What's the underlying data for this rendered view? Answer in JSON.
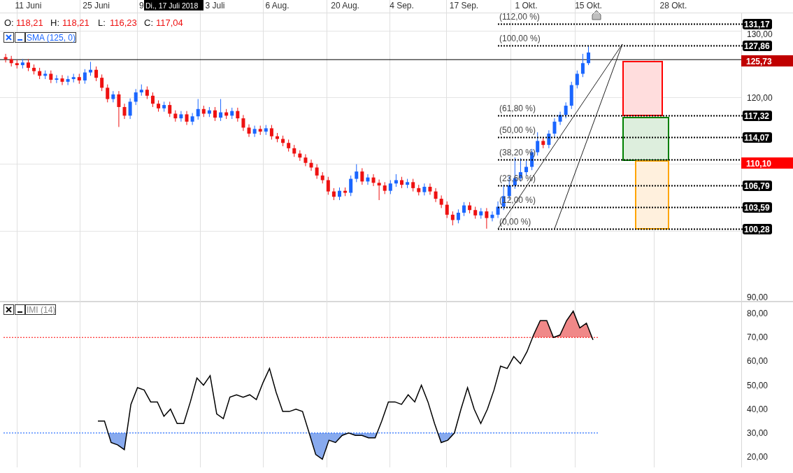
{
  "date_axis": {
    "crosshair_date": "Di., 17 Juli 2018"
  },
  "ohlc": [
    {
      "label": "O:",
      "value": "118,21"
    },
    {
      "label": "H:",
      "value": "118,21"
    },
    {
      "label": "L:",
      "value": "116,23"
    },
    {
      "label": "C:",
      "value": "117,04"
    }
  ],
  "price_indicator": {
    "name": "SMA (125, 0)"
  },
  "price_pane": {
    "chart_data": {
      "type": "candlestick",
      "grid": true,
      "ylim": [
        89.44,
        134.7
      ],
      "categories": [
        null,
        null,
        null,
        null,
        "11 Juni",
        null,
        null,
        null,
        null,
        null,
        null,
        null,
        null,
        null,
        null,
        null,
        "25 Juni",
        null,
        null,
        null,
        null,
        null,
        null,
        null,
        "9",
        null,
        null,
        null,
        null,
        null,
        null,
        null,
        null,
        null,
        null,
        null,
        null,
        "3 Juli",
        null,
        null,
        null,
        null,
        null,
        null,
        null,
        null,
        null,
        null,
        "6 Aug.",
        null,
        null,
        null,
        null,
        null,
        null,
        null,
        null,
        null,
        null,
        null,
        "20 Aug.",
        null,
        null,
        null,
        null,
        null,
        null,
        null,
        null,
        null,
        "4 Sep.",
        null,
        null,
        null,
        null,
        null,
        null,
        null,
        null,
        null,
        null,
        "17 Sep.",
        null,
        null,
        null,
        null,
        null,
        null,
        null,
        null,
        null,
        null,
        "1 Okt.",
        null,
        null,
        null,
        null,
        null,
        null,
        null,
        null,
        null,
        null,
        "15 Okt.",
        null,
        null,
        null,
        null,
        null,
        null,
        null,
        null,
        null,
        null,
        null,
        null,
        null,
        null,
        "28 Okt.",
        null,
        null,
        null,
        null,
        null,
        null,
        null,
        null,
        null,
        null,
        null
      ],
      "ref_lines": [
        {
          "axis": "y",
          "value": 125.73,
          "color": "#000000"
        }
      ],
      "yticks": [
        {
          "value": 130,
          "label": "130,00"
        },
        {
          "value": 120,
          "label": "120,00"
        },
        {
          "value": 90,
          "label": "90,00"
        }
      ],
      "ohlc": [
        [
          126.1,
          126.6,
          125.3,
          125.8
        ],
        [
          125.8,
          126.3,
          124.7,
          125.2
        ],
        [
          125.2,
          125.7,
          124.4,
          124.9
        ],
        [
          124.9,
          125.8,
          124.4,
          125.3
        ],
        [
          125.3,
          125.8,
          124.0,
          124.5
        ],
        [
          124.5,
          125.0,
          123.5,
          124.0
        ],
        [
          124.0,
          124.5,
          122.8,
          123.3
        ],
        [
          123.3,
          124.1,
          122.8,
          123.6
        ],
        [
          123.6,
          124.1,
          122.2,
          122.7
        ],
        [
          122.7,
          123.4,
          122.2,
          122.9
        ],
        [
          122.9,
          123.4,
          121.9,
          122.4
        ],
        [
          122.4,
          123.3,
          121.9,
          122.8
        ],
        [
          122.8,
          123.6,
          122.3,
          123.1
        ],
        [
          123.1,
          123.6,
          122.1,
          122.6
        ],
        [
          122.6,
          124.3,
          122.1,
          123.8
        ],
        [
          123.8,
          125.4,
          123.3,
          124.2
        ],
        [
          124.2,
          124.7,
          122.5,
          123.0
        ],
        [
          123.0,
          123.5,
          121.0,
          121.5
        ],
        [
          121.5,
          122.0,
          119.3,
          119.8
        ],
        [
          119.8,
          121.0,
          119.3,
          120.5
        ],
        [
          120.5,
          121.0,
          115.6,
          118.6
        ],
        [
          118.6,
          119.1,
          116.8,
          117.3
        ],
        [
          117.3,
          119.9,
          116.8,
          119.4
        ],
        [
          119.4,
          121.3,
          118.9,
          120.8
        ],
        [
          120.8,
          122.0,
          120.3,
          121.2
        ],
        [
          121.2,
          121.7,
          119.8,
          120.3
        ],
        [
          120.3,
          120.8,
          118.6,
          119.1
        ],
        [
          119.1,
          119.6,
          117.9,
          118.4
        ],
        [
          118.4,
          119.4,
          117.9,
          118.9
        ],
        [
          118.9,
          119.4,
          117.1,
          117.6
        ],
        [
          117.6,
          118.1,
          116.4,
          116.9
        ],
        [
          116.9,
          118.0,
          116.4,
          117.5
        ],
        [
          117.5,
          118.0,
          115.9,
          116.4
        ],
        [
          116.4,
          117.7,
          115.9,
          117.2
        ],
        [
          117.2,
          119.8,
          116.7,
          118.3
        ],
        [
          118.3,
          118.8,
          117.1,
          117.6
        ],
        [
          117.6,
          118.6,
          117.1,
          118.1
        ],
        [
          118.1,
          118.6,
          116.5,
          117.0
        ],
        [
          117.0,
          119.8,
          116.5,
          117.8
        ],
        [
          117.8,
          118.3,
          116.8,
          117.3
        ],
        [
          117.3,
          118.5,
          116.8,
          118.0
        ],
        [
          118.0,
          118.5,
          116.4,
          116.9
        ],
        [
          116.9,
          117.4,
          115.0,
          115.5
        ],
        [
          115.5,
          116.0,
          114.1,
          114.6
        ],
        [
          114.6,
          115.8,
          114.1,
          115.3
        ],
        [
          115.3,
          115.8,
          114.4,
          114.9
        ],
        [
          114.9,
          115.9,
          114.4,
          115.4
        ],
        [
          115.4,
          115.9,
          113.7,
          114.2
        ],
        [
          114.2,
          114.7,
          113.3,
          113.8
        ],
        [
          113.8,
          114.3,
          112.7,
          113.2
        ],
        [
          113.2,
          113.7,
          111.9,
          112.4
        ],
        [
          112.4,
          112.9,
          111.1,
          111.6
        ],
        [
          111.6,
          112.1,
          110.5,
          111.0
        ],
        [
          111.0,
          111.5,
          109.7,
          110.2
        ],
        [
          110.2,
          110.7,
          109.0,
          109.5
        ],
        [
          109.5,
          110.0,
          107.8,
          108.3
        ],
        [
          108.3,
          108.8,
          107.1,
          107.6
        ],
        [
          107.6,
          108.1,
          105.4,
          105.9
        ],
        [
          105.9,
          106.4,
          104.6,
          105.1
        ],
        [
          105.1,
          106.5,
          104.6,
          106.0
        ],
        [
          106.0,
          106.5,
          105.2,
          105.7
        ],
        [
          105.7,
          108.3,
          105.2,
          107.8
        ],
        [
          107.8,
          110.0,
          107.3,
          108.9
        ],
        [
          108.9,
          109.4,
          106.9,
          107.4
        ],
        [
          107.4,
          108.5,
          106.9,
          108.0
        ],
        [
          108.0,
          108.5,
          106.7,
          107.2
        ],
        [
          107.2,
          107.7,
          104.6,
          106.8
        ],
        [
          106.8,
          107.3,
          105.5,
          106.0
        ],
        [
          106.0,
          107.6,
          105.5,
          107.1
        ],
        [
          107.1,
          108.5,
          106.6,
          107.6
        ],
        [
          107.6,
          108.1,
          106.4,
          106.9
        ],
        [
          106.9,
          107.8,
          106.4,
          107.3
        ],
        [
          107.3,
          107.8,
          105.9,
          106.4
        ],
        [
          106.4,
          106.9,
          105.3,
          105.8
        ],
        [
          105.8,
          107.1,
          105.3,
          106.6
        ],
        [
          106.6,
          107.1,
          105.4,
          105.9
        ],
        [
          105.9,
          106.4,
          104.3,
          104.8
        ],
        [
          104.8,
          105.3,
          103.4,
          103.9
        ],
        [
          103.9,
          104.4,
          101.9,
          102.4
        ],
        [
          102.4,
          102.9,
          100.8,
          101.6
        ],
        [
          101.6,
          103.2,
          101.1,
          102.7
        ],
        [
          102.7,
          104.3,
          102.2,
          103.8
        ],
        [
          103.8,
          104.3,
          102.6,
          103.1
        ],
        [
          103.1,
          103.6,
          101.8,
          102.3
        ],
        [
          102.3,
          103.4,
          101.8,
          102.9
        ],
        [
          102.9,
          103.4,
          100.3,
          101.9
        ],
        [
          101.9,
          102.9,
          101.4,
          102.4
        ],
        [
          102.4,
          104.4,
          101.9,
          103.6
        ],
        [
          103.6,
          106.9,
          103.1,
          105.2
        ],
        [
          105.2,
          108.2,
          104.7,
          106.8
        ],
        [
          106.8,
          111.0,
          106.3,
          107.9
        ],
        [
          107.9,
          110.9,
          107.4,
          108.8
        ],
        [
          108.8,
          110.5,
          108.3,
          109.6
        ],
        [
          109.6,
          112.3,
          109.1,
          111.8
        ],
        [
          111.8,
          114.8,
          111.3,
          113.5
        ],
        [
          113.5,
          114.0,
          112.4,
          112.9
        ],
        [
          112.9,
          115.1,
          112.4,
          114.6
        ],
        [
          114.6,
          116.9,
          114.1,
          116.4
        ],
        [
          116.4,
          117.9,
          115.9,
          117.4
        ],
        [
          117.4,
          119.3,
          116.9,
          118.8
        ],
        [
          118.8,
          122.4,
          118.3,
          121.9
        ],
        [
          121.9,
          124.1,
          121.4,
          123.6
        ],
        [
          123.6,
          126.6,
          123.1,
          125.2
        ],
        [
          125.2,
          127.86,
          124.9,
          126.8
        ],
        null,
        null,
        null,
        null,
        null,
        null,
        null,
        null,
        null,
        null,
        null,
        null,
        null,
        null,
        null,
        null,
        null,
        null,
        null,
        null,
        null,
        null,
        null,
        null,
        null,
        null
      ]
    }
  },
  "fib_levels": [
    {
      "label": "(112,00 %)",
      "price": "131,17"
    },
    {
      "label": "(100,00 %)",
      "price": "127,86"
    },
    {
      "label": "(61,80 %)",
      "price": "117,32"
    },
    {
      "label": "(50,00 %)",
      "price": "114,07"
    },
    {
      "label": "(38,20 %)"
    },
    {
      "label": "(23,60 %)",
      "price": "106,79"
    },
    {
      "label": "(12,00 %)",
      "price": "103,59"
    },
    {
      "label": "(0,00 %)",
      "price": "100,28"
    }
  ],
  "price_markers": [
    {
      "price": "125,73",
      "color": "#c00000"
    },
    {
      "price": "110,10",
      "color": "#ff0000"
    }
  ],
  "zones": [
    {
      "color": "#ff0000"
    },
    {
      "color": "#008000"
    },
    {
      "color": "#ffa500"
    }
  ],
  "indicator_pane": {
    "chart_data": {
      "type": "line",
      "grid": true,
      "ylim": [
        15.6,
        85.3
      ],
      "yticks": [
        {
          "value": 80,
          "label": "80,00"
        },
        {
          "value": 70,
          "label": "70,00"
        },
        {
          "value": 60,
          "label": "60,00"
        },
        {
          "value": 50,
          "label": "50,00"
        },
        {
          "value": 40,
          "label": "40,00"
        },
        {
          "value": 30,
          "label": "30,00"
        },
        {
          "value": 20,
          "label": "20,00"
        }
      ],
      "series": [
        {
          "name": "IMI (14)",
          "color": "#000000",
          "values": [
            35,
            35,
            26,
            25,
            23,
            42,
            49,
            48,
            43,
            43,
            37,
            40,
            34,
            34,
            43,
            53,
            50,
            54,
            38,
            36,
            45,
            46,
            45,
            46,
            44,
            51,
            57,
            47,
            39,
            39,
            40,
            39,
            30,
            21,
            19,
            27,
            26,
            29,
            30,
            29,
            29,
            28,
            28,
            35,
            43,
            43,
            42,
            46,
            43,
            50,
            43,
            34,
            26,
            27,
            30,
            40,
            49,
            40,
            34,
            40,
            48,
            58,
            57,
            62,
            59,
            64,
            71,
            77,
            77,
            70,
            71,
            77,
            81,
            74,
            76,
            69
          ]
        }
      ],
      "ref_lines": [
        {
          "axis": "y",
          "value": 70,
          "color": "#ff0000"
        },
        {
          "axis": "y",
          "value": 30,
          "color": "#0055ff"
        }
      ]
    }
  }
}
